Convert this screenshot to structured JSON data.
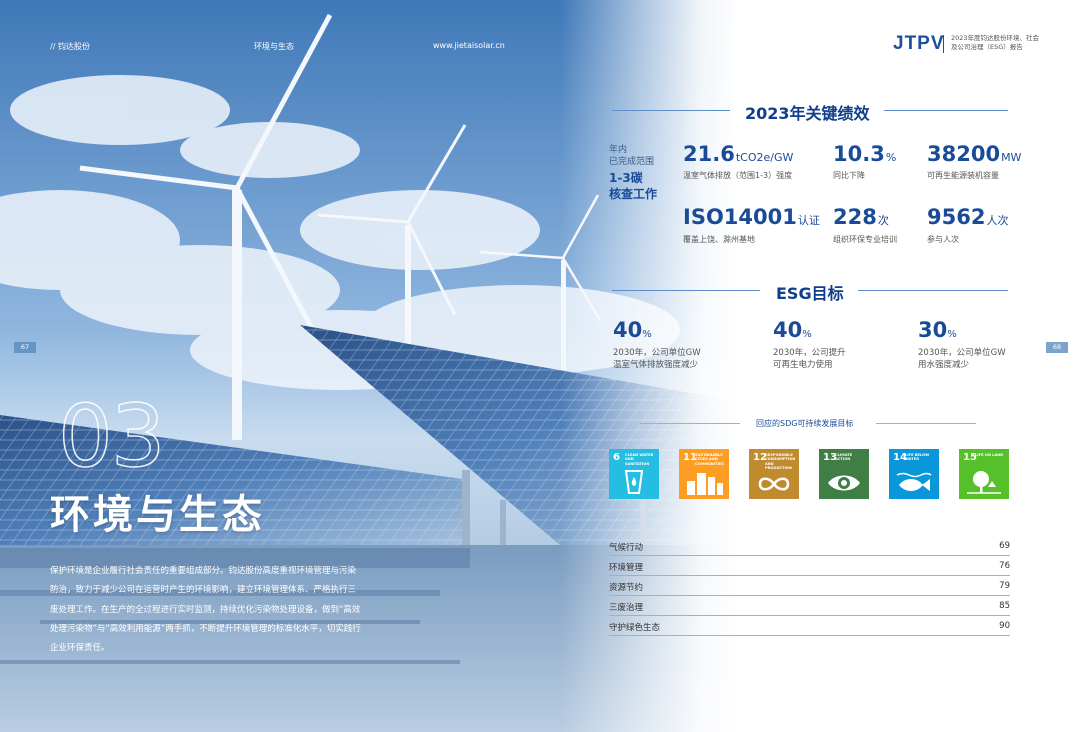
{
  "header": {
    "brand_name": "// 钧达股份",
    "section_name": "环境与生态",
    "website": "www.jietaisolar.cn",
    "logo_text": "JTPV",
    "report_title": "2023年度钧达股份环境、社会及公司治理（ESG）报告"
  },
  "page_numbers": {
    "left": "67",
    "right": "68"
  },
  "chapter": {
    "number": "03",
    "title": "环境与生态",
    "body": "保护环境是企业履行社会责任的重要组成部分。钧达股份高度重视环境管理与污染防治，致力于减少公司在运营时产生的环境影响，建立环境管理体系、严格执行三废处理工作。在生产的全过程进行实时监测，持续优化污染物处理设备，做到“高效处理污染物”与“高效利用能源”两手抓，不断提升环境管理的标准化水平，切实践行企业环保责任。"
  },
  "kpi_section": {
    "title": "2023年关键绩效",
    "side_line1": "年内",
    "side_line2": "已完成范围",
    "side_strong1": "1-3碳",
    "side_strong2": "核查工作",
    "items": [
      {
        "value": "21.6",
        "unit": "tCO2e/GW",
        "label": "温室气体排放（范围1-3）强度"
      },
      {
        "value": "10.3",
        "unit": "%",
        "label": "同比下降"
      },
      {
        "value": "38200",
        "unit": "MW",
        "label": "可再生能源装机容量"
      },
      {
        "value": "ISO14001",
        "unit": "认证",
        "label": "覆盖上饶、滁州基地"
      },
      {
        "value": "228",
        "unit": "次",
        "label": "组织环保专业培训"
      },
      {
        "value": "9562",
        "unit": "人次",
        "label": "参与人次"
      }
    ]
  },
  "esg_goals": {
    "title": "ESG目标",
    "items": [
      {
        "value": "40",
        "unit": "%",
        "line1": "2030年，公司单位GW",
        "line2": "温室气体排放强度减少"
      },
      {
        "value": "40",
        "unit": "%",
        "line1": "2030年，公司提升",
        "line2": "可再生电力使用"
      },
      {
        "value": "30",
        "unit": "%",
        "line1": "2030年，公司单位GW",
        "line2": "用水强度减少"
      }
    ]
  },
  "sdg": {
    "title": "回应的SDG可持续发展目标",
    "goals": [
      {
        "num": "6",
        "text": "CLEAN WATER AND SANITATION",
        "color": "#26BDE2",
        "icon": "water-glass-icon"
      },
      {
        "num": "11",
        "text": "SUSTAINABLE CITIES AND COMMUNITIES",
        "color": "#FD9D24",
        "icon": "city-icon"
      },
      {
        "num": "12",
        "text": "RESPONSIBLE CONSUMPTION AND PRODUCTION",
        "color": "#BF8B2E",
        "icon": "infinity-icon"
      },
      {
        "num": "13",
        "text": "CLIMATE ACTION",
        "color": "#3F7E44",
        "icon": "eye-earth-icon"
      },
      {
        "num": "14",
        "text": "LIFE BELOW WATER",
        "color": "#0A97D9",
        "icon": "fish-icon"
      },
      {
        "num": "15",
        "text": "LIFE ON LAND",
        "color": "#56C02B",
        "icon": "tree-icon"
      }
    ]
  },
  "toc": [
    {
      "label": "气候行动",
      "page": "69"
    },
    {
      "label": "环境管理",
      "page": "76"
    },
    {
      "label": "资源节约",
      "page": "79"
    },
    {
      "label": "三废治理",
      "page": "85"
    },
    {
      "label": "守护绿色生态",
      "page": "90"
    }
  ]
}
